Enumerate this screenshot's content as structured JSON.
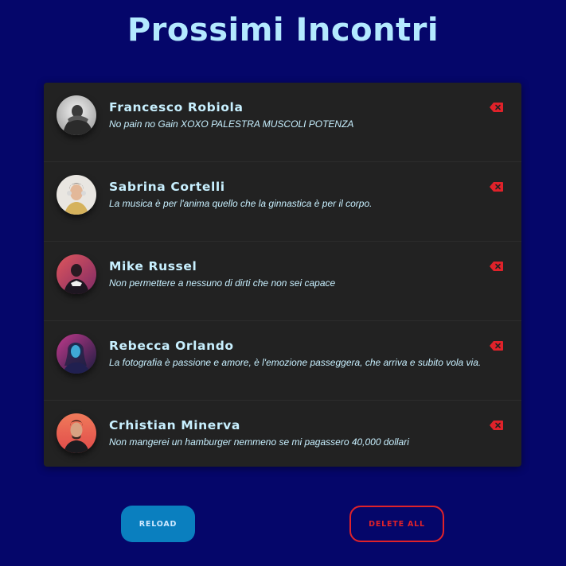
{
  "page": {
    "title": "Prossimi Incontri"
  },
  "colors": {
    "background": "#05066a",
    "card": "#222222",
    "title": "#b3e9ff",
    "text": "#c8f0ff",
    "reload": "#0a7fbf",
    "danger": "#e0222a"
  },
  "contacts": [
    {
      "name": "Francesco Robiola",
      "quote": "No pain no Gain XOXO PALESTRA MUSCOLI POTENZA",
      "avatar": "avatar-photo-man-grayscale",
      "delete_icon": "backspace-icon"
    },
    {
      "name": "Sabrina Cortelli",
      "quote": "La musica è per l'anima quello che la ginnastica è per il corpo.",
      "avatar": "avatar-photo-woman-headphones",
      "delete_icon": "backspace-icon"
    },
    {
      "name": "Mike Russel",
      "quote": "Non permettere a nessuno di dirti che non sei capace",
      "avatar": "avatar-photo-man-neon",
      "delete_icon": "backspace-icon"
    },
    {
      "name": "Rebecca Orlando",
      "quote": "La fotografia è passione e amore, è l'emozione passeggera, che arriva e subito vola via.",
      "avatar": "avatar-photo-woman-neon",
      "delete_icon": "backspace-icon"
    },
    {
      "name": "Crhistian Minerva",
      "quote": "Non mangerei un hamburger nemmeno se mi pagassero 40,000 dollari",
      "avatar": "avatar-photo-man-orange",
      "delete_icon": "backspace-icon"
    }
  ],
  "actions": {
    "reload_label": "RELOAD",
    "delete_all_label": "DELETE ALL"
  }
}
